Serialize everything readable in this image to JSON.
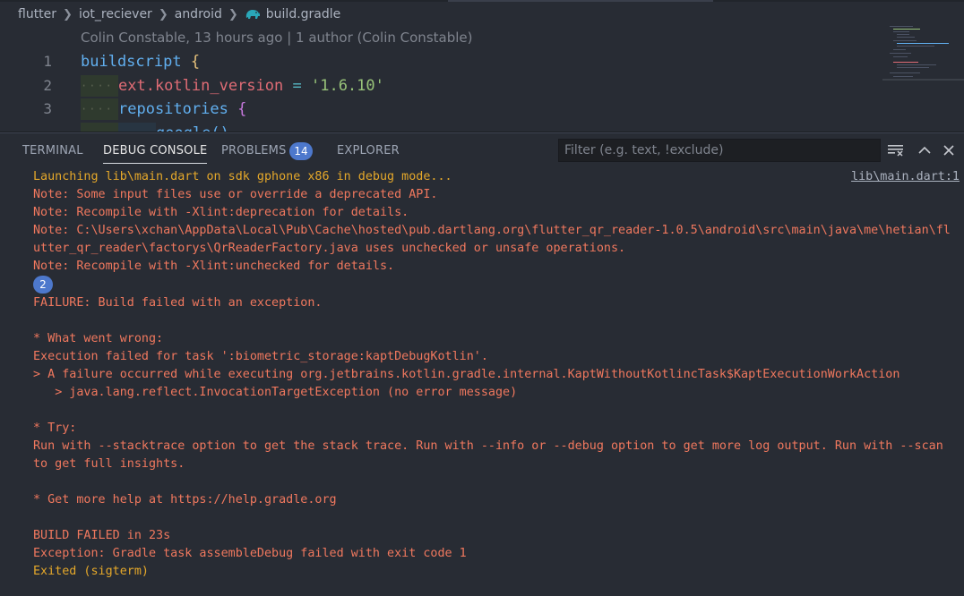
{
  "breadcrumb": {
    "items": [
      "flutter",
      "iot_reciever",
      "android"
    ],
    "file": "build.gradle"
  },
  "blame": "Colin Constable, 13 hours ago | 1 author (Colin Constable)",
  "editor": {
    "line_numbers": [
      "1",
      "2",
      "3"
    ],
    "line1": {
      "fn": "buildscript",
      "brace": "{"
    },
    "line2": {
      "prop": "ext.kotlin_version",
      "op": "=",
      "str": "'1.6.10'"
    },
    "line3": {
      "fn": "repositories",
      "brace": "{"
    },
    "line4": {
      "fn": "google",
      "parens": "()"
    }
  },
  "panel": {
    "tabs": [
      "TERMINAL",
      "DEBUG CONSOLE",
      "PROBLEMS",
      "EXPLORER"
    ],
    "active_tab": "DEBUG CONSOLE",
    "problems_count": "14",
    "filter_placeholder": "Filter (e.g. text, !exclude)"
  },
  "console": {
    "source_link": "lib\\main.dart:1",
    "launch": "Launching lib\\main.dart on sdk gphone x86 in debug mode...",
    "lines": [
      "Note: Some input files use or override a deprecated API.",
      "Note: Recompile with -Xlint:deprecation for details.",
      "Note: C:\\Users\\xchan\\AppData\\Local\\Pub\\Cache\\hosted\\pub.dartlang.org\\flutter_qr_reader-1.0.5\\android\\src\\main\\java\\me\\hetian\\flutter_qr_reader\\factorys\\QrReaderFactory.java uses unchecked or unsafe operations.",
      "Note: Recompile with -Xlint:unchecked for details."
    ],
    "repeat_count": "2",
    "lines2": [
      "FAILURE: Build failed with an exception.",
      "",
      "* What went wrong:",
      "Execution failed for task ':biometric_storage:kaptDebugKotlin'.",
      "> A failure occurred while executing org.jetbrains.kotlin.gradle.internal.KaptWithoutKotlincTask$KaptExecutionWorkAction",
      "   > java.lang.reflect.InvocationTargetException (no error message)",
      "",
      "* Try:",
      "Run with --stacktrace option to get the stack trace. Run with --info or --debug option to get more log output. Run with --scan to get full insights.",
      "",
      "* Get more help at https://help.gradle.org",
      "",
      "BUILD FAILED in 23s",
      "Exception: Gradle task assembleDebug failed with exit code 1"
    ],
    "exit": "Exited (sigterm)"
  },
  "colors": {
    "error_text": "#f0785e",
    "warning_text": "#e5a82a",
    "badge": "#4d78cc",
    "background": "#282c34"
  },
  "icons": [
    "chevron-right-icon",
    "gradle-elephant-icon",
    "clear-console-icon",
    "maximize-panel-icon",
    "close-panel-icon"
  ]
}
